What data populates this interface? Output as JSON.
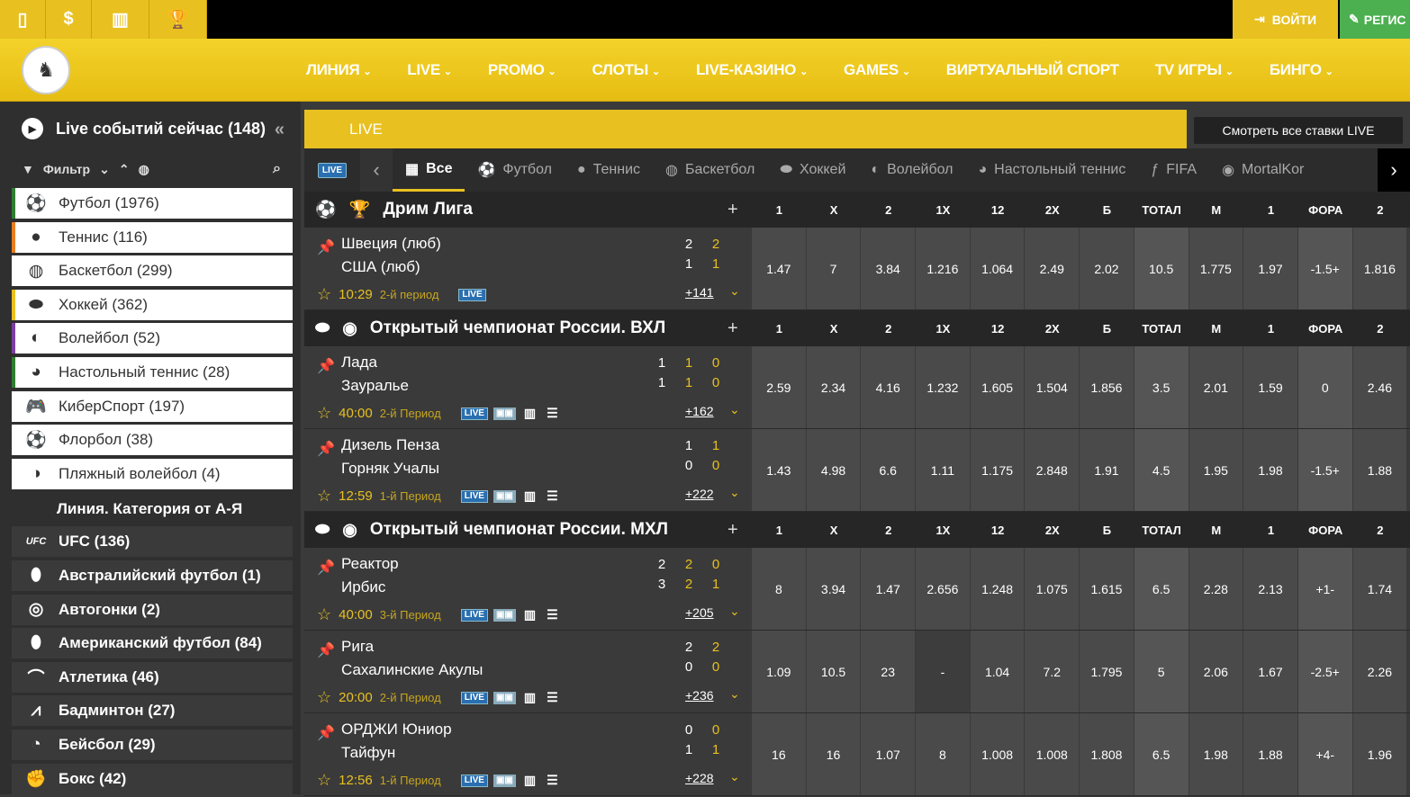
{
  "topbar": {
    "icons": [
      "mobile-icon",
      "dollar-icon",
      "chart-icon",
      "trophy-icon"
    ],
    "login_label": "ВОЙТИ",
    "register_label": "РЕГИС"
  },
  "nav": {
    "items": [
      "ЛИНИЯ",
      "LIVE",
      "PROMO",
      "СЛОТЫ",
      "LIVE-КАЗИНО",
      "GAMES",
      "ВИРТУАЛЬНЫЙ СПОРТ",
      "TV ИГРЫ",
      "БИНГО"
    ],
    "dropdown": [
      true,
      true,
      true,
      true,
      true,
      true,
      false,
      true,
      true
    ]
  },
  "sidebar": {
    "title": "Live событий сейчас (148)",
    "filter_label": "Фильтр",
    "live_items": [
      {
        "label": "Футбол (1976)",
        "icon": "soccer-ball-icon",
        "accent": "#2e7d32"
      },
      {
        "label": "Теннис (116)",
        "icon": "tennis-ball-icon",
        "accent": "#e67e22"
      },
      {
        "label": "Баскетбол (299)",
        "icon": "basketball-icon",
        "accent": "#ffffff"
      },
      {
        "label": "Хоккей (362)",
        "icon": "hockey-puck-icon",
        "accent": "#e8c020"
      },
      {
        "label": "Волейбол (52)",
        "icon": "volleyball-icon",
        "accent": "#7b3fa0"
      },
      {
        "label": "Настольный теннис (28)",
        "icon": "table-tennis-icon",
        "accent": "#2e7d32"
      },
      {
        "label": "КиберСпорт (197)",
        "icon": "gamepad-icon",
        "accent": "#ffffff"
      },
      {
        "label": "Флорбол (38)",
        "icon": "floorball-icon",
        "accent": "#ffffff"
      },
      {
        "label": "Пляжный волейбол (4)",
        "icon": "beach-volleyball-icon",
        "accent": "#ffffff"
      }
    ],
    "line_header": "Линия. Категория от А-Я",
    "line_items": [
      {
        "label": "UFC (136)",
        "icon": "ufc-icon"
      },
      {
        "label": "Австралийский футбол (1)",
        "icon": "aussie-football-icon"
      },
      {
        "label": "Автогонки (2)",
        "icon": "steering-wheel-icon"
      },
      {
        "label": "Американский футбол (84)",
        "icon": "american-football-icon"
      },
      {
        "label": "Атлетика (46)",
        "icon": "sneaker-icon"
      },
      {
        "label": "Бадминтон (27)",
        "icon": "shuttlecock-icon"
      },
      {
        "label": "Бейсбол (29)",
        "icon": "baseball-icon"
      },
      {
        "label": "Бокс (42)",
        "icon": "boxing-glove-icon"
      }
    ]
  },
  "main": {
    "live_label": "LIVE",
    "all_bets_label": "Смотреть все ставки LIVE",
    "tabs": [
      "Все",
      "Футбол",
      "Теннис",
      "Баскетбол",
      "Хоккей",
      "Волейбол",
      "Настольный теннис",
      "FIFA",
      "MortalKor"
    ],
    "columns": [
      "1",
      "X",
      "2",
      "1X",
      "12",
      "2X",
      "Б",
      "ТОТАЛ",
      "М",
      "1",
      "ФОРА",
      "2"
    ],
    "leagues": [
      {
        "name": "Дрим Лига",
        "sport_icon": "soccer-ball-icon",
        "flag": "trophy-icon",
        "events": [
          {
            "team1": "Швеция (люб)",
            "team2": "США (люб)",
            "s1": [
              "2",
              "2"
            ],
            "s2": [
              "1",
              "1"
            ],
            "time": "10:29",
            "period": "2-й период",
            "more": "+141",
            "full": false,
            "odds": [
              "1.47",
              "7",
              "3.84",
              "1.216",
              "1.064",
              "2.49",
              "2.02",
              "10.5",
              "1.775",
              "1.97",
              "-1.5+",
              "1.816"
            ]
          }
        ]
      },
      {
        "name": "Открытый чемпионат России. ВХЛ",
        "sport_icon": "hockey-puck-icon",
        "flag": "russia-flag-icon",
        "events": [
          {
            "team1": "Лада",
            "team2": "Зауралье",
            "s1": [
              "1",
              "1",
              "0"
            ],
            "s2": [
              "1",
              "1",
              "0"
            ],
            "time": "40:00",
            "period": "2-й Период",
            "more": "+162",
            "full": true,
            "odds": [
              "2.59",
              "2.34",
              "4.16",
              "1.232",
              "1.605",
              "1.504",
              "1.856",
              "3.5",
              "2.01",
              "1.59",
              "0",
              "2.46"
            ]
          },
          {
            "team1": "Дизель Пенза",
            "team2": "Горняк Учалы",
            "s1": [
              "1",
              "1"
            ],
            "s2": [
              "0",
              "0"
            ],
            "time": "12:59",
            "period": "1-й Период",
            "more": "+222",
            "full": true,
            "odds": [
              "1.43",
              "4.98",
              "6.6",
              "1.11",
              "1.175",
              "2.848",
              "1.91",
              "4.5",
              "1.95",
              "1.98",
              "-1.5+",
              "1.88"
            ]
          }
        ]
      },
      {
        "name": "Открытый чемпионат России. МХЛ",
        "sport_icon": "hockey-puck-icon",
        "flag": "russia-flag-icon",
        "events": [
          {
            "team1": "Реактор",
            "team2": "Ирбис",
            "s1": [
              "2",
              "2",
              "0"
            ],
            "s2": [
              "3",
              "2",
              "1"
            ],
            "time": "40:00",
            "period": "3-й Период",
            "more": "+205",
            "full": true,
            "odds": [
              "8",
              "3.94",
              "1.47",
              "2.656",
              "1.248",
              "1.075",
              "1.615",
              "6.5",
              "2.28",
              "2.13",
              "+1-",
              "1.74"
            ]
          },
          {
            "team1": "Рига",
            "team2": "Сахалинские Акулы",
            "s1": [
              "2",
              "2"
            ],
            "s2": [
              "0",
              "0"
            ],
            "time": "20:00",
            "period": "2-й Период",
            "more": "+236",
            "full": true,
            "odds": [
              "1.09",
              "10.5",
              "23",
              "-",
              "1.04",
              "7.2",
              "1.795",
              "5",
              "2.06",
              "1.67",
              "-2.5+",
              "2.26"
            ]
          },
          {
            "team1": "ОРДЖИ Юниор",
            "team2": "Тайфун",
            "s1": [
              "0",
              "0"
            ],
            "s2": [
              "1",
              "1"
            ],
            "time": "12:56",
            "period": "1-й Период",
            "more": "+228",
            "full": true,
            "odds": [
              "16",
              "16",
              "1.07",
              "8",
              "1.008",
              "1.008",
              "1.808",
              "6.5",
              "1.98",
              "1.88",
              "+4-",
              "1.96"
            ]
          }
        ]
      }
    ]
  },
  "colors": {
    "accent": "#e8c020",
    "register": "#4caf50",
    "live_badge": "#2a6fb0"
  }
}
